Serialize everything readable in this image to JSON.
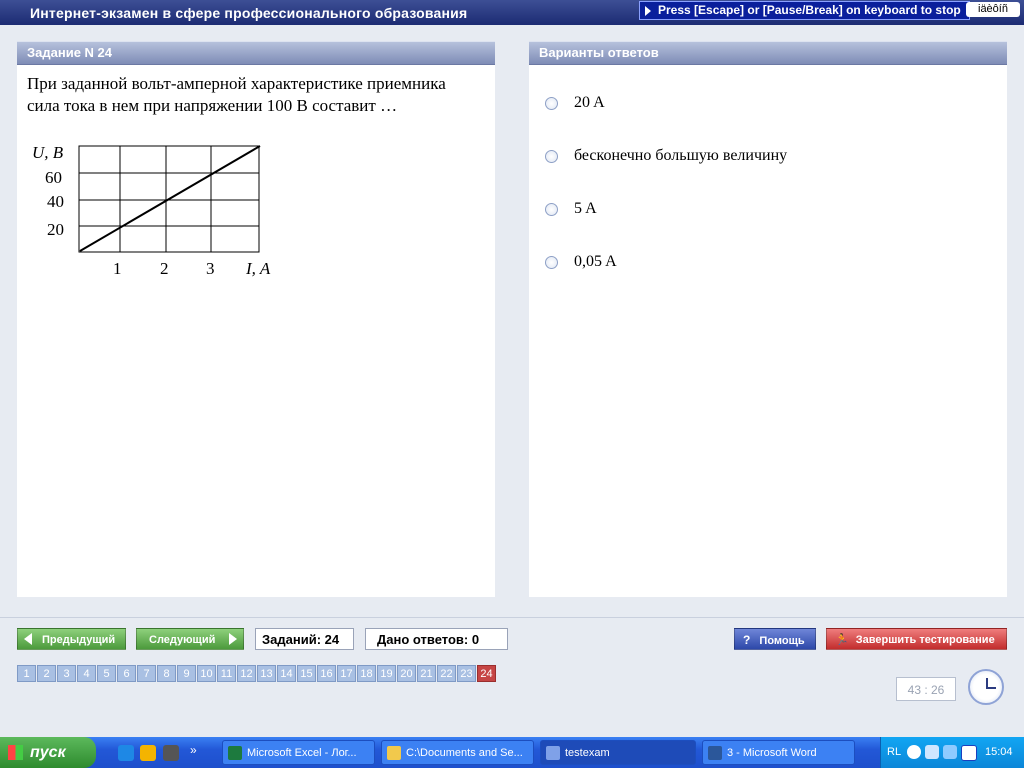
{
  "title": "Интернет-экзамен в сфере профессионального образования",
  "escape_hint": "Press [Escape] or [Pause/Break] on keyboard to stop",
  "lang_indicator": "iäèôíñ",
  "question_panel": {
    "header": "Задание N 24",
    "text": "При заданной вольт-амперной характеристике приемника сила тока в нем при напряжении 100 В составит …",
    "graph": {
      "y_label": "U, B",
      "x_label": "I, A",
      "y_ticks": [
        "60",
        "40",
        "20"
      ],
      "x_ticks": [
        "1",
        "2",
        "3"
      ]
    }
  },
  "answers_panel": {
    "header": "Варианты ответов",
    "options": [
      "20 A",
      "бесконечно большую величину",
      "5 A",
      "0,05 A"
    ]
  },
  "nav": {
    "prev": "Предыдущий",
    "next": "Следующий",
    "tasks_count": "Заданий: 24",
    "answers_given": "Дано ответов: 0",
    "help": "Помощь",
    "finish": "Завершить тестирование"
  },
  "pages": [
    "1",
    "2",
    "3",
    "4",
    "5",
    "6",
    "7",
    "8",
    "9",
    "10",
    "11",
    "12",
    "13",
    "14",
    "15",
    "16",
    "17",
    "18",
    "19",
    "20",
    "21",
    "22",
    "23",
    "24"
  ],
  "current_page": "24",
  "timer": "43 : 26",
  "taskbar": {
    "start": "пуск",
    "tasks": [
      "Microsoft Excel - Лог...",
      "C:\\Documents and Se...",
      "testexam",
      "3 - Microsoft Word"
    ],
    "lang": "RL",
    "time": "15:04"
  },
  "colors": {
    "title_bar": "#1c2b73",
    "panel_header": "#7e8cb6",
    "current_page": "#c64545"
  }
}
